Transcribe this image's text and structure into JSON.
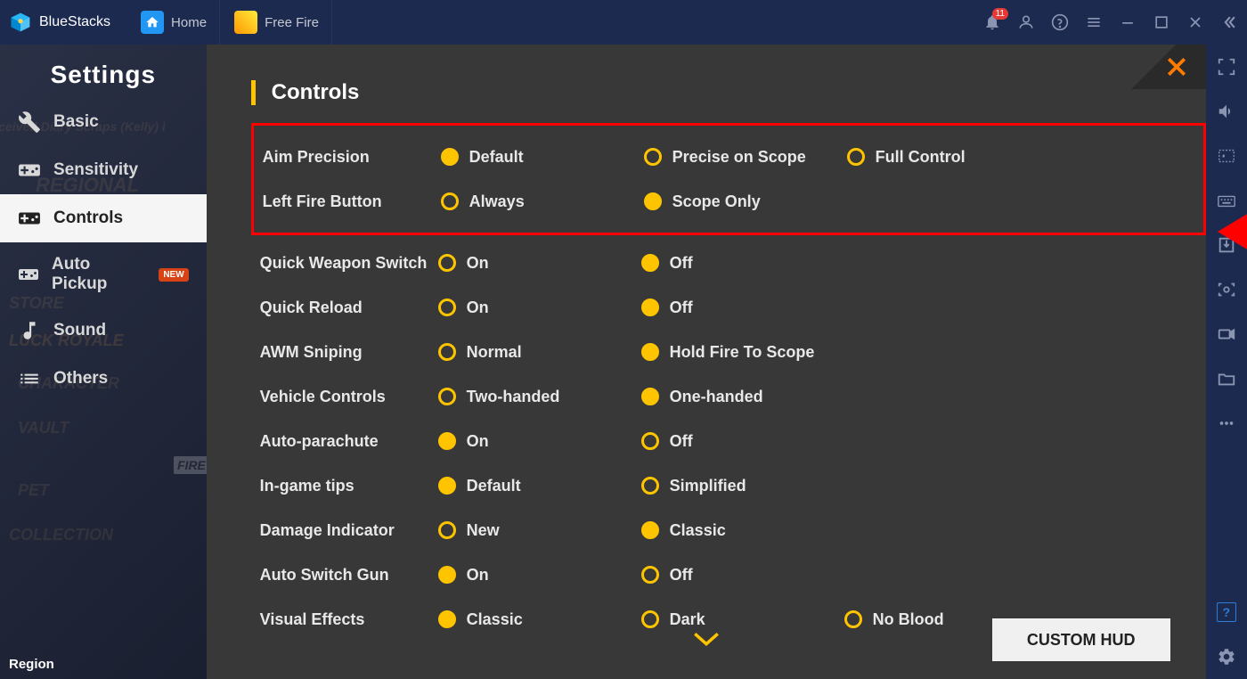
{
  "titlebar": {
    "app_name": "BlueStacks",
    "notification_count": "11",
    "tabs": [
      {
        "label": "Home"
      },
      {
        "label": "Free Fire"
      }
    ]
  },
  "sidebar": {
    "title": "Settings",
    "region_label": "Region",
    "items": [
      {
        "label": "Basic",
        "icon": "wrench-icon",
        "new": false
      },
      {
        "label": "Sensitivity",
        "icon": "gamepad-icon",
        "new": false
      },
      {
        "label": "Controls",
        "icon": "gamepad-icon",
        "new": false,
        "active": true
      },
      {
        "label": "Auto Pickup",
        "icon": "gamepad-icon",
        "new": true
      },
      {
        "label": "Sound",
        "icon": "music-icon",
        "new": false
      },
      {
        "label": "Others",
        "icon": "list-icon",
        "new": false
      }
    ],
    "bg_items": [
      "received Diary Scraps (Kelly) i",
      "REGIONAL",
      "STORE",
      "LUCK ROYALE",
      "CHARACTER",
      "VAULT",
      "PET",
      "COLLECTION",
      "FIRE"
    ]
  },
  "content": {
    "title": "Controls",
    "custom_hud_label": "CUSTOM HUD",
    "highlighted_rows": [
      {
        "label": "Aim Precision",
        "options": [
          {
            "label": "Default",
            "selected": true
          },
          {
            "label": "Precise on Scope",
            "selected": false
          },
          {
            "label": "Full Control",
            "selected": false
          }
        ]
      },
      {
        "label": "Left Fire Button",
        "options": [
          {
            "label": "Always",
            "selected": false
          },
          {
            "label": "Scope Only",
            "selected": true
          }
        ]
      }
    ],
    "rows": [
      {
        "label": "Quick Weapon Switch",
        "options": [
          {
            "label": "On",
            "selected": false
          },
          {
            "label": "Off",
            "selected": true
          }
        ]
      },
      {
        "label": "Quick Reload",
        "options": [
          {
            "label": "On",
            "selected": false
          },
          {
            "label": "Off",
            "selected": true
          }
        ]
      },
      {
        "label": "AWM Sniping",
        "options": [
          {
            "label": "Normal",
            "selected": false
          },
          {
            "label": "Hold Fire To Scope",
            "selected": true
          }
        ]
      },
      {
        "label": "Vehicle Controls",
        "options": [
          {
            "label": "Two-handed",
            "selected": false
          },
          {
            "label": "One-handed",
            "selected": true
          }
        ]
      },
      {
        "label": "Auto-parachute",
        "options": [
          {
            "label": "On",
            "selected": true
          },
          {
            "label": "Off",
            "selected": false
          }
        ]
      },
      {
        "label": "In-game tips",
        "options": [
          {
            "label": "Default",
            "selected": true
          },
          {
            "label": "Simplified",
            "selected": false
          }
        ]
      },
      {
        "label": "Damage Indicator",
        "options": [
          {
            "label": "New",
            "selected": false
          },
          {
            "label": "Classic",
            "selected": true
          }
        ]
      },
      {
        "label": "Auto Switch Gun",
        "options": [
          {
            "label": "On",
            "selected": true
          },
          {
            "label": "Off",
            "selected": false
          }
        ]
      },
      {
        "label": "Visual Effects",
        "options": [
          {
            "label": "Classic",
            "selected": true
          },
          {
            "label": "Dark",
            "selected": false
          },
          {
            "label": "No Blood",
            "selected": false
          }
        ]
      }
    ]
  }
}
